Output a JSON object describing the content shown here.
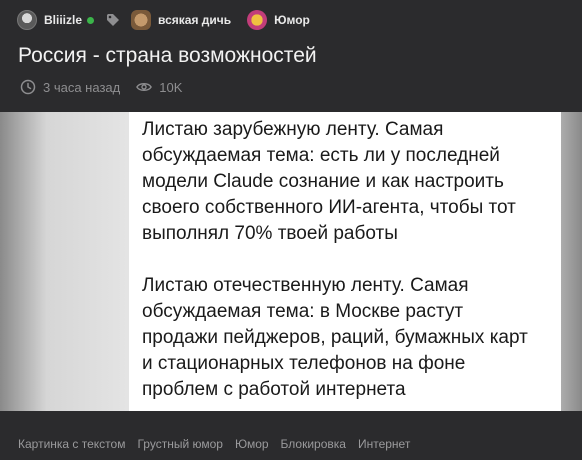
{
  "author": {
    "name": "Bliiizle",
    "online": true
  },
  "communities": [
    {
      "name": "всякая дичь"
    },
    {
      "name": "Юмор"
    }
  ],
  "post": {
    "title": "Россия - страна возможностей",
    "time": "3 часа назад",
    "views": "10K"
  },
  "image_text": {
    "lines": [
      "Листаю зарубежную ленту. Самая",
      "обсуждаемая тема: есть ли у последней",
      "модели Claude сознание и как настроить",
      "своего собственного ИИ-агента, чтобы тот",
      "выполнял 70% твоей работы",
      "",
      "Листаю отечественную ленту. Самая",
      "обсуждаемая тема: в Москве растут",
      "продажи пейджеров, раций, бумажных карт",
      "и стационарных телефонов на фоне",
      "проблем с работой интернета"
    ]
  },
  "tags": [
    "Картинка с текстом",
    "Грустный юмор",
    "Юмор",
    "Блокировка",
    "Интернет"
  ],
  "colors": {
    "background": "#2b2b2d",
    "online": "#3bb54a",
    "muted": "#8e8e90"
  },
  "icons": [
    "tag-icon",
    "clock-icon",
    "eye-icon"
  ]
}
